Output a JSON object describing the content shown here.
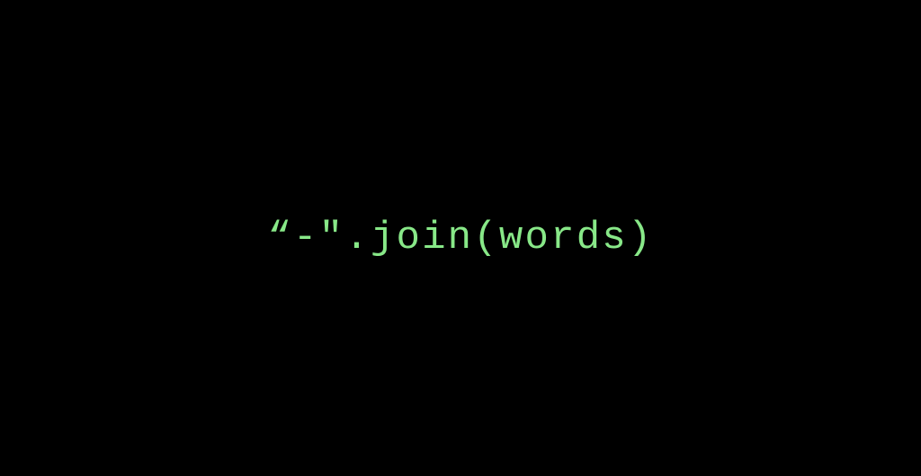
{
  "code": {
    "text": "“-\".join(words)",
    "color": "#88e888"
  }
}
